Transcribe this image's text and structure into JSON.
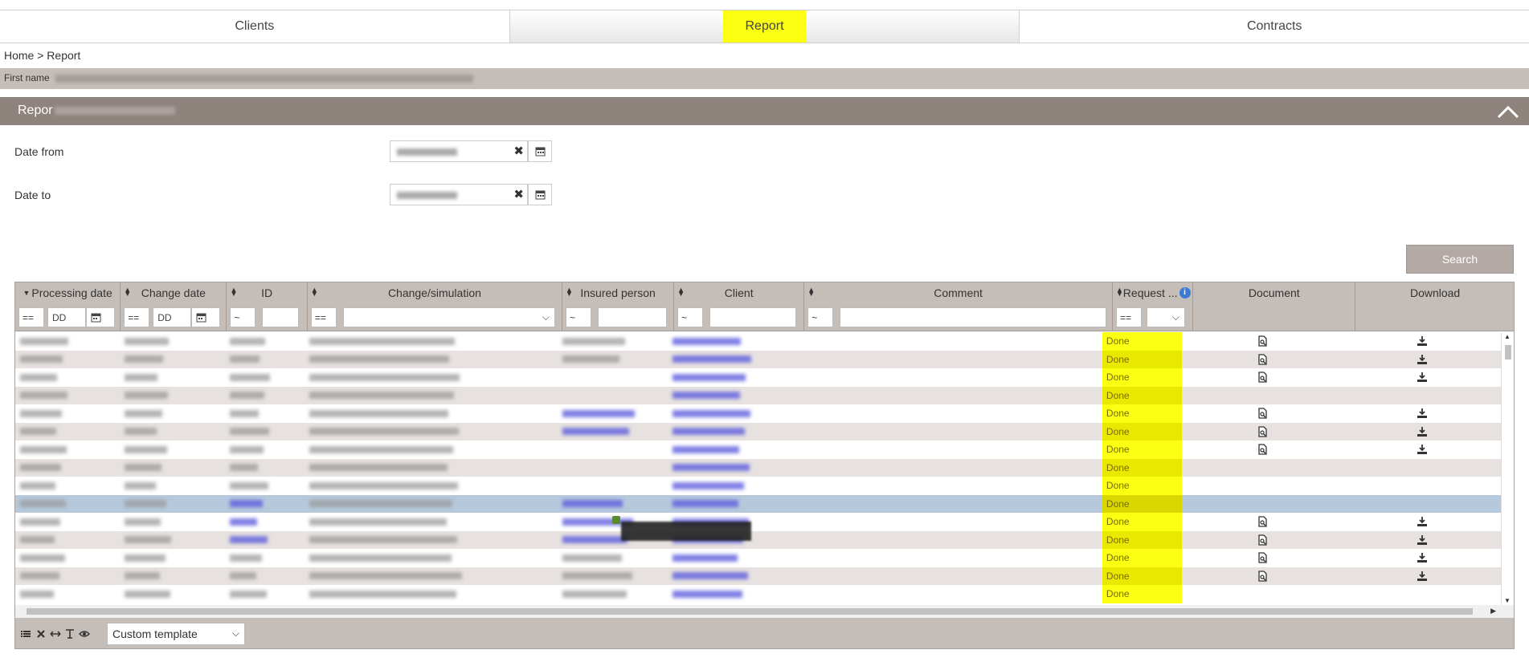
{
  "tabs": [
    {
      "label": "Clients",
      "active": false
    },
    {
      "label": "Report",
      "active": true
    },
    {
      "label": "Contracts",
      "active": false
    }
  ],
  "breadcrumb": "Home > Report",
  "info_bar": {
    "label": "First name"
  },
  "panel": {
    "title": "Repor"
  },
  "form": {
    "date_from_label": "Date from",
    "date_to_label": "Date to"
  },
  "search_label": "Search",
  "grid": {
    "columns": [
      "Processing date",
      "Change date",
      "ID",
      "Change/simulation",
      "Insured person",
      "Client",
      "Comment",
      "Request ...",
      "Document",
      "Download"
    ],
    "filters": {
      "op_eq": "==",
      "op_like": "~",
      "date_placeholder_1": "DD",
      "date_placeholder_2": "DD"
    },
    "rows": [
      {
        "status": "Done",
        "doc": true,
        "dl": true,
        "selected": false
      },
      {
        "status": "Done",
        "doc": true,
        "dl": true,
        "selected": false
      },
      {
        "status": "Done",
        "doc": true,
        "dl": true,
        "selected": false
      },
      {
        "status": "Done",
        "doc": false,
        "dl": false,
        "selected": false
      },
      {
        "status": "Done",
        "doc": true,
        "dl": true,
        "selected": false
      },
      {
        "status": "Done",
        "doc": true,
        "dl": true,
        "selected": false
      },
      {
        "status": "Done",
        "doc": true,
        "dl": true,
        "selected": false
      },
      {
        "status": "Done",
        "doc": false,
        "dl": false,
        "selected": false
      },
      {
        "status": "Done",
        "doc": false,
        "dl": false,
        "selected": false
      },
      {
        "status": "Done",
        "doc": false,
        "dl": false,
        "selected": true
      },
      {
        "status": "Done",
        "doc": true,
        "dl": true,
        "selected": false
      },
      {
        "status": "Done",
        "doc": true,
        "dl": true,
        "selected": false
      },
      {
        "status": "Done",
        "doc": true,
        "dl": true,
        "selected": false
      },
      {
        "status": "Done",
        "doc": true,
        "dl": true,
        "selected": false
      },
      {
        "status": "Done",
        "doc": false,
        "dl": false,
        "selected": false
      }
    ]
  },
  "footer": {
    "template_value": "Custom template"
  },
  "colors": {
    "highlight": "#fbff12",
    "header_bg": "#8f837e",
    "grid_bg": "#c5bdb8",
    "selected_row": "#b6c9dc"
  }
}
